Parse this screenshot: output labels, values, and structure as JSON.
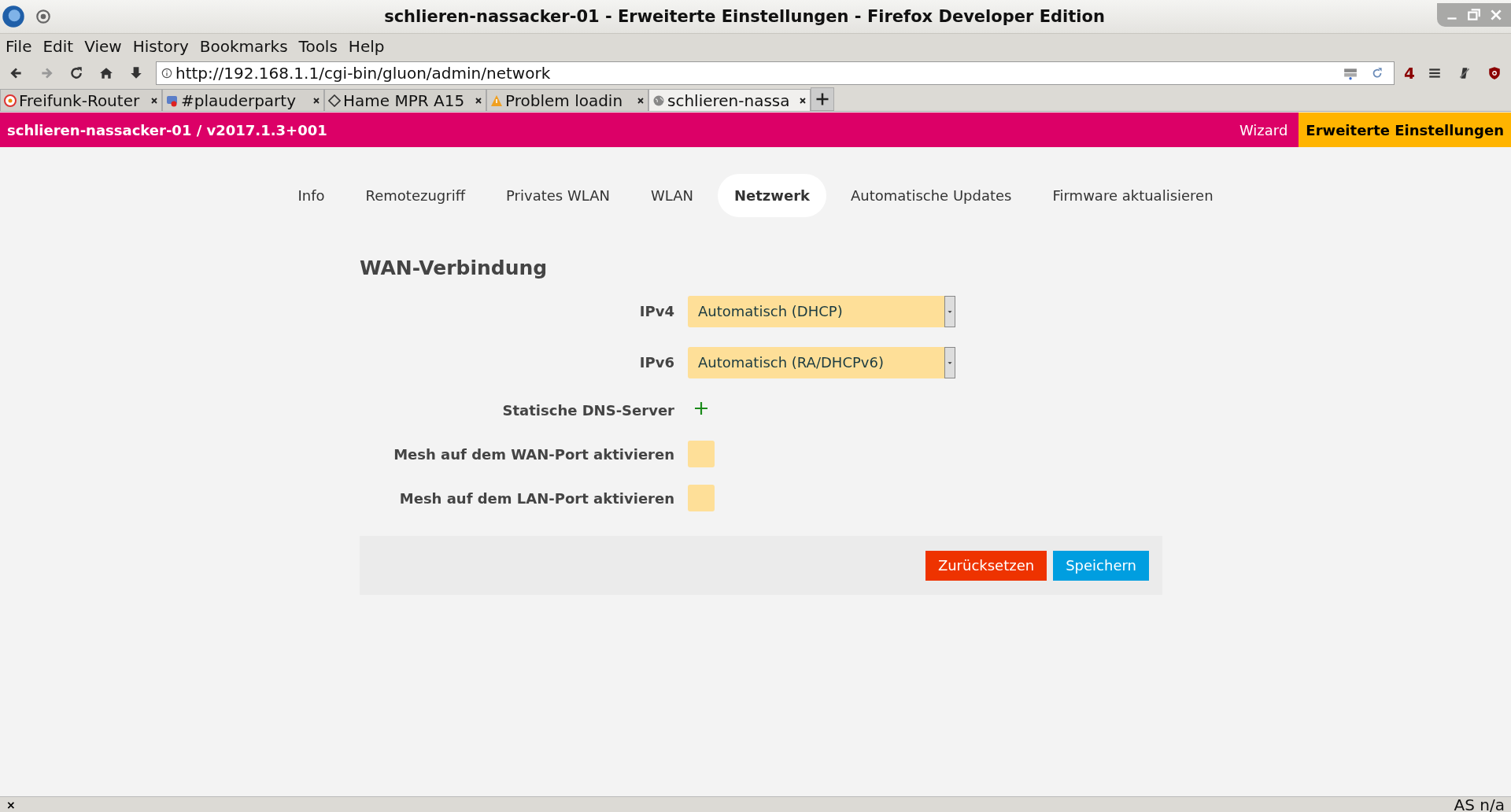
{
  "window": {
    "title": "schlieren-nassacker-01 - Erweiterte Einstellungen - Firefox Developer Edition"
  },
  "menu": [
    "File",
    "Edit",
    "View",
    "History",
    "Bookmarks",
    "Tools",
    "Help"
  ],
  "address_bar": {
    "value": "http://192.168.1.1/cgi-bin/gluon/admin/network"
  },
  "toolbar_badge": "4",
  "browser_tabs": [
    {
      "label": "Freifunk-Router",
      "selected": false,
      "kind": "router"
    },
    {
      "label": "#plauderparty",
      "selected": false,
      "kind": "chat"
    },
    {
      "label": "Hame MPR A15",
      "selected": false,
      "kind": "diamond"
    },
    {
      "label": "Problem loadin",
      "selected": false,
      "kind": "warning"
    },
    {
      "label": "schlieren-nassa",
      "selected": true,
      "kind": "globe"
    }
  ],
  "header": {
    "title": "schlieren-nassacker-01 / v2017.1.3+001",
    "links": [
      {
        "label": "Wizard",
        "selected": false
      },
      {
        "label": "Erweiterte Einstellungen",
        "selected": true
      }
    ]
  },
  "nav_tabs": [
    {
      "label": "Info",
      "selected": false
    },
    {
      "label": "Remotezugriff",
      "selected": false
    },
    {
      "label": "Privates WLAN",
      "selected": false
    },
    {
      "label": "WLAN",
      "selected": false
    },
    {
      "label": "Netzwerk",
      "selected": true
    },
    {
      "label": "Automatische Updates",
      "selected": false
    },
    {
      "label": "Firmware aktualisieren",
      "selected": false
    }
  ],
  "section": {
    "title": "WAN-Verbindung",
    "fields": [
      {
        "kind": "select",
        "label": "IPv4",
        "value": "Automatisch (DHCP)"
      },
      {
        "kind": "select",
        "label": "IPv6",
        "value": "Automatisch (RA/DHCPv6)"
      },
      {
        "kind": "add",
        "label": "Statische DNS-Server"
      },
      {
        "kind": "checkbox",
        "label": "Mesh auf dem WAN-Port aktivieren",
        "checked": false
      },
      {
        "kind": "checkbox",
        "label": "Mesh auf dem LAN-Port aktivieren",
        "checked": false
      }
    ]
  },
  "buttons": [
    {
      "label": "Zurücksetzen",
      "kind": "reset"
    },
    {
      "label": "Speichern",
      "kind": "save"
    }
  ],
  "status_bar": {
    "close": "×",
    "text": "AS n/a"
  }
}
